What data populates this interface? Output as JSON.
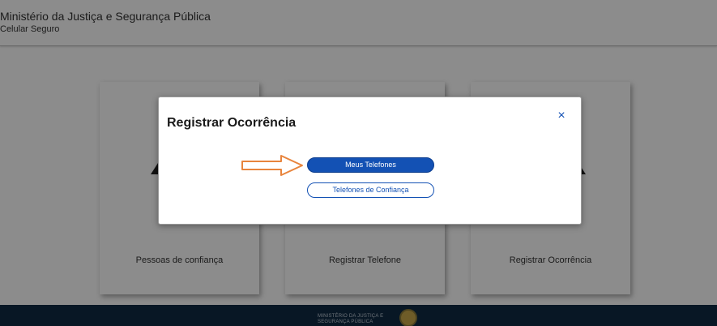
{
  "header": {
    "org_name": "Ministério da Justiça e Segurança Pública",
    "app_name": "Celular Seguro"
  },
  "cards": [
    {
      "label": "Pessoas de confiança"
    },
    {
      "label": "Registrar Telefone"
    },
    {
      "label": "Registrar Ocorrência"
    }
  ],
  "footer": {
    "line1": "MINISTÉRIO DA JUSTIÇA E",
    "line2": "SEGURANÇA PÚBLICA"
  },
  "modal": {
    "title": "Registrar Ocorrência",
    "close_icon": "×",
    "primary_button": "Meus Telefones",
    "secondary_button": "Telefones de Confiança"
  },
  "colors": {
    "accent": "#1351b4",
    "footer_bg": "#0f2a44",
    "annotation_arrow": "#e8843c"
  }
}
